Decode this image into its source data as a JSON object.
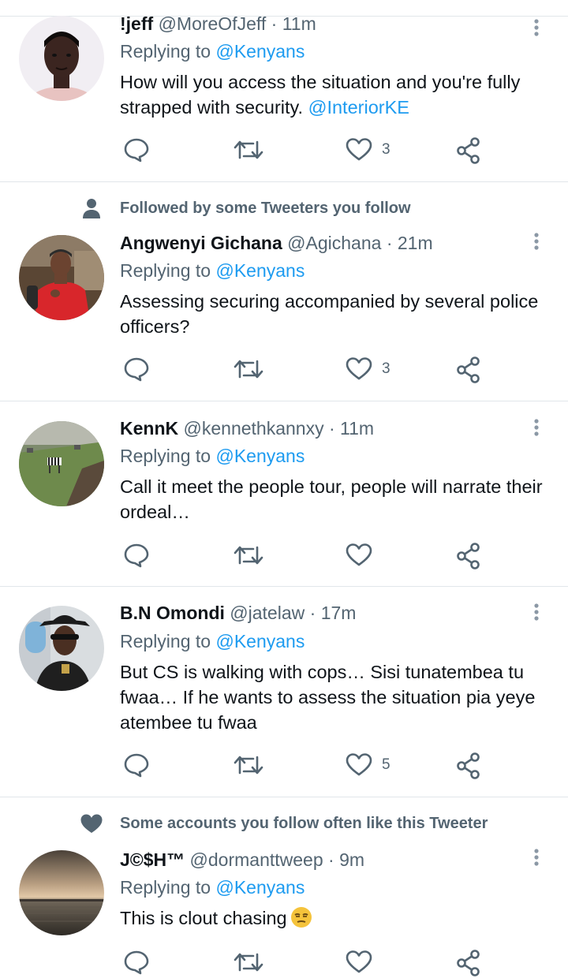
{
  "social_context": {
    "followed": "Followed by some Tweeters you follow",
    "often_like": "Some accounts you follow often like this Tweeter"
  },
  "tweets": [
    {
      "name": "!jeff",
      "handle": "@MoreOfJeff",
      "separator": "·",
      "time": "11m",
      "replying_prefix": "Replying to ",
      "replying_to": "@Kenyans",
      "text_1": "How will you access the situation and you're fully strapped with security. ",
      "text_mention": "@InteriorKE",
      "likes": "3"
    },
    {
      "name": "Angwenyi Gichana",
      "handle": "@Agichana",
      "separator": "·",
      "time": "21m",
      "replying_prefix": "Replying to ",
      "replying_to": "@Kenyans",
      "text": "Assessing securing accompanied by several police officers?",
      "likes": "3"
    },
    {
      "name": "KennK",
      "handle": "@kennethkannxy",
      "separator": "·",
      "time": "11m",
      "replying_prefix": "Replying to ",
      "replying_to": "@Kenyans",
      "text": "Call it meet the people tour, people will narrate their ordeal…",
      "likes": ""
    },
    {
      "name": "B.N Omondi",
      "handle": "@jatelaw",
      "separator": "·",
      "time": "17m",
      "replying_prefix": "Replying to ",
      "replying_to": "@Kenyans",
      "text": "But CS is walking with cops… Sisi tunatembea tu fwaa… If he wants to assess the situation pia yeye atembee tu fwaa",
      "likes": "5"
    },
    {
      "name": "J©$H™",
      "handle": "@dormanttweep",
      "separator": "·",
      "time": "9m",
      "replying_prefix": "Replying to ",
      "replying_to": "@Kenyans",
      "text": "This is clout chasing",
      "emoji": "unamused-face-emoji",
      "likes": ""
    }
  ],
  "icons": {
    "reply": "reply-icon",
    "retweet": "retweet-icon",
    "like": "heart-icon",
    "share": "share-icon",
    "more": "more-options-icon",
    "person": "person-icon",
    "heart_filled": "heart-filled-icon"
  },
  "colors": {
    "text": "#0f1419",
    "secondary": "#536471",
    "link": "#1d9bf0",
    "divider": "#e1e6ea",
    "icon": "#536471"
  }
}
